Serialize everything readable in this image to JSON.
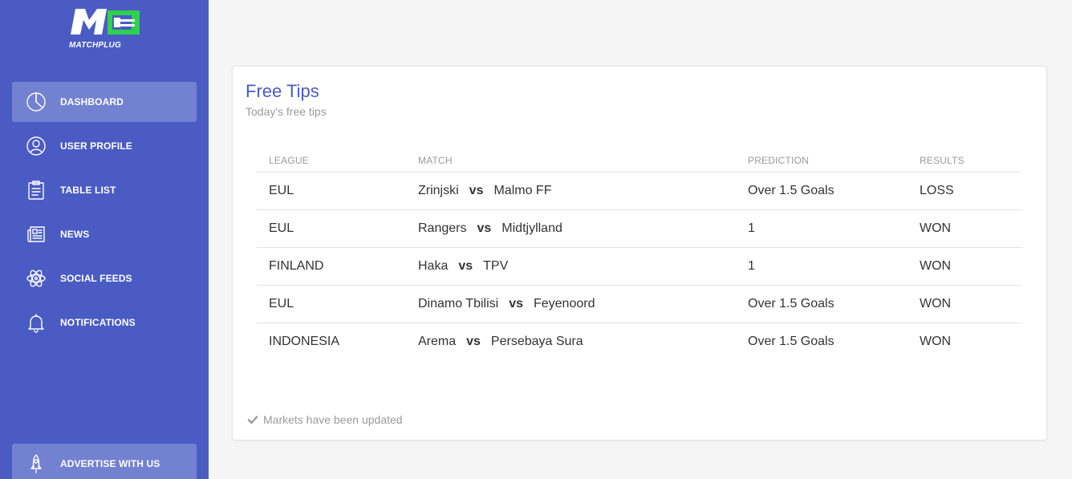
{
  "brand": {
    "logo_letters": "M",
    "logo_plug": "MATCHPLUG",
    "colors": {
      "sidebar": "#4a5bc4",
      "accent": "#2ed14a"
    }
  },
  "sidebar": {
    "items": [
      {
        "label": "DASHBOARD",
        "icon": "pie-chart-icon",
        "active": true
      },
      {
        "label": "USER PROFILE",
        "icon": "user-icon",
        "active": false
      },
      {
        "label": "TABLE LIST",
        "icon": "clipboard-list-icon",
        "active": false
      },
      {
        "label": "NEWS",
        "icon": "newspaper-icon",
        "active": false
      },
      {
        "label": "SOCIAL FEEDS",
        "icon": "atom-icon",
        "active": false
      },
      {
        "label": "NOTIFICATIONS",
        "icon": "bell-icon",
        "active": false
      }
    ],
    "advertise": {
      "label": "ADVERTISE WITH US",
      "icon": "rocket-icon"
    }
  },
  "card": {
    "title": "Free Tips",
    "subtitle": "Today's free tips",
    "columns": [
      "LEAGUE",
      "MATCH",
      "PREDICTION",
      "RESULTS"
    ],
    "vs_label": "vs",
    "rows": [
      {
        "league": "EUL",
        "home": "Zrinjski",
        "away": "Malmo FF",
        "prediction": "Over 1.5 Goals",
        "result": "LOSS"
      },
      {
        "league": "EUL",
        "home": "Rangers",
        "away": "Midtjylland",
        "prediction": "1",
        "result": "WON"
      },
      {
        "league": "FINLAND",
        "home": "Haka",
        "away": "TPV",
        "prediction": "1",
        "result": "WON"
      },
      {
        "league": "EUL",
        "home": "Dinamo Tbilisi",
        "away": "Feyenoord",
        "prediction": "Over 1.5 Goals",
        "result": "WON"
      },
      {
        "league": "INDONESIA",
        "home": "Arema",
        "away": "Persebaya Sura",
        "prediction": "Over 1.5 Goals",
        "result": "WON"
      }
    ],
    "footer": {
      "icon": "check-icon",
      "text": "Markets have been updated"
    }
  }
}
